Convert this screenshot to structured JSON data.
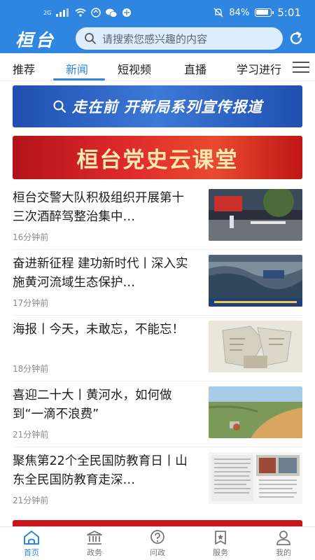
{
  "status_bar": {
    "network": "2G",
    "battery": "84%",
    "time": "5:01"
  },
  "header": {
    "logo": "桓台",
    "search_placeholder": "请搜索您感兴趣的内容",
    "icons": [
      "search-icon",
      "refresh-icon"
    ]
  },
  "tabs": [
    {
      "label": "推荐",
      "active": false
    },
    {
      "label": "新闻",
      "active": true
    },
    {
      "label": "短视频",
      "active": false
    },
    {
      "label": "直播",
      "active": false
    },
    {
      "label": "学习进行",
      "active": false
    }
  ],
  "banners": {
    "top": "走在前 开新局系列宣传报道",
    "party": "桓台党史云课堂"
  },
  "news": [
    {
      "title": "桓台交警大队积极组织开展第十三次酒醉驾整治集中…",
      "time": "16分钟前"
    },
    {
      "title": "奋进新征程 建功新时代丨深入实施黄河流域生态保护…",
      "time": "17分钟前"
    },
    {
      "title": "海报丨今天，未敢忘，不能忘！",
      "time": "18分钟前"
    },
    {
      "title": "喜迎二十大丨黄河水，如何做到“一滴不浪费”",
      "time": "21分钟前"
    },
    {
      "title": "聚焦第22个全民国防教育日丨山东全民国防教育走深…",
      "time": "21分钟前"
    }
  ],
  "bottom_nav": [
    {
      "label": "首页",
      "icon": "home-icon",
      "active": true
    },
    {
      "label": "政务",
      "icon": "government-icon",
      "active": false
    },
    {
      "label": "问政",
      "icon": "question-icon",
      "active": false
    },
    {
      "label": "服务",
      "icon": "service-star-icon",
      "active": false
    },
    {
      "label": "我的",
      "icon": "user-icon",
      "active": false
    }
  ],
  "colors": {
    "brand_blue": "#2f86e0",
    "party_red": "#d81e1e"
  }
}
